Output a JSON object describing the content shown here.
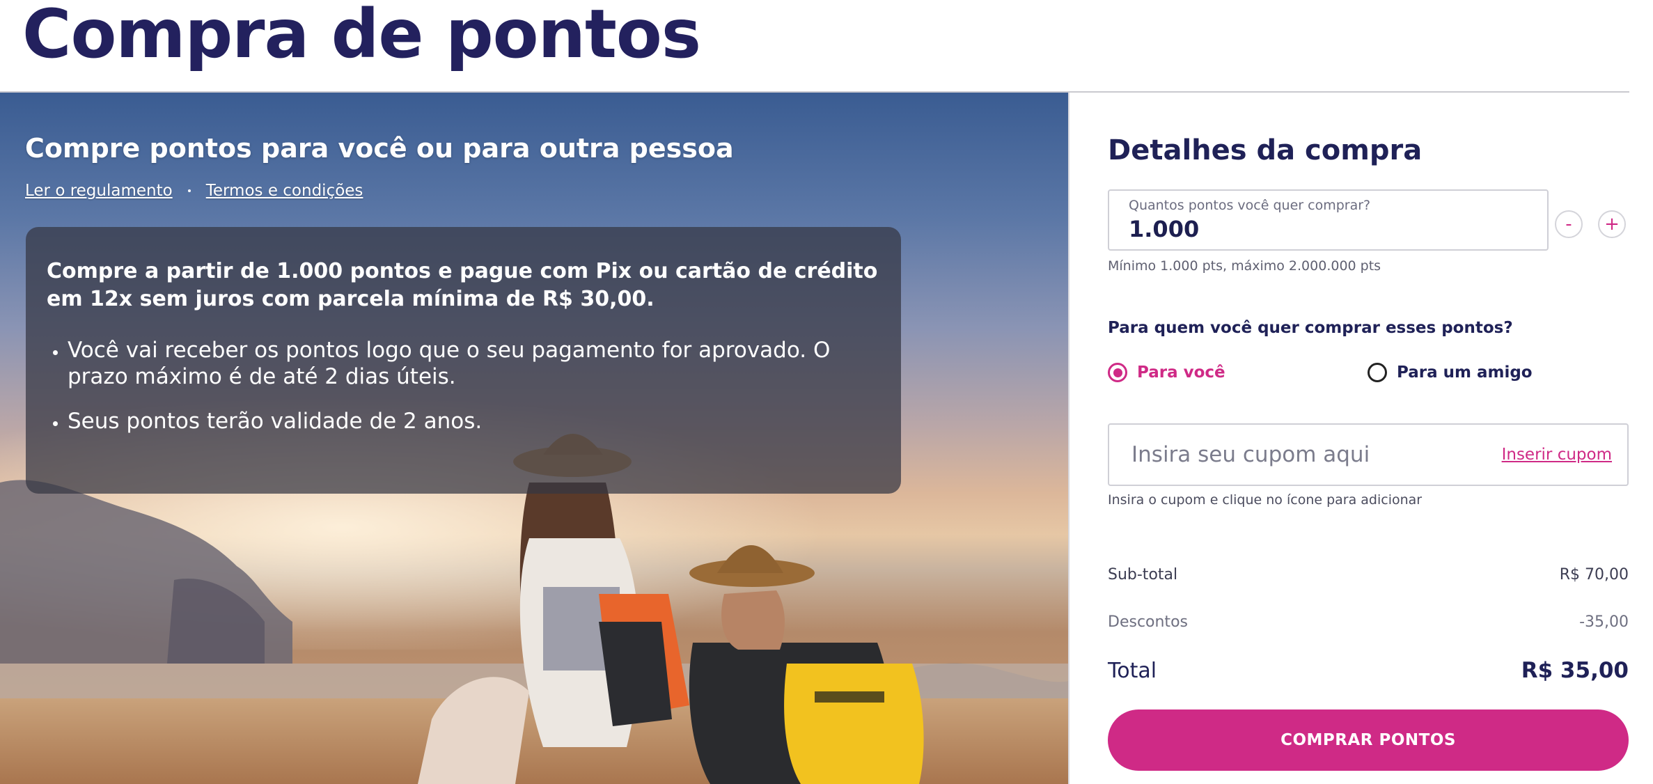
{
  "page": {
    "title": "Compra de pontos"
  },
  "hero": {
    "heading": "Compre pontos para você ou para outra pessoa",
    "links": {
      "rules": "Ler o regulamento",
      "terms": "Termos e condições"
    },
    "card": {
      "lead": "Compre a partir de 1.000 pontos e pague com Pix ou cartão de crédito em 12x sem juros com parcela mínima de R$ 30,00.",
      "bullets": [
        "Você vai receber os pontos logo que o seu pagamento for aprovado. O prazo máximo é de até 2 dias úteis.",
        "Seus pontos terão validade de 2 anos."
      ]
    }
  },
  "panel": {
    "title": "Detalhes da compra",
    "quantity": {
      "label": "Quantos pontos você quer comprar?",
      "value": "1.000",
      "decrement": "-",
      "increment": "+",
      "hint": "Mínimo 1.000 pts, máximo 2.000.000 pts"
    },
    "recipient": {
      "question": "Para quem você quer comprar esses pontos?",
      "options": [
        {
          "label": "Para você",
          "selected": true
        },
        {
          "label": "Para um amigo",
          "selected": false
        }
      ]
    },
    "coupon": {
      "placeholder": "Insira seu cupom aqui",
      "action": "Inserir cupom",
      "hint": "Insira o cupom e clique no ícone para adicionar"
    },
    "summary": {
      "subtotal_label": "Sub-total",
      "subtotal_value": "R$ 70,00",
      "discount_label": "Descontos",
      "discount_value": "-35,00",
      "total_label": "Total",
      "total_value": "R$ 35,00"
    },
    "buy_button": "COMPRAR PONTOS"
  },
  "colors": {
    "brand_navy": "#23215e",
    "accent_pink": "#cf2a86",
    "card_overlay": "#343642"
  }
}
